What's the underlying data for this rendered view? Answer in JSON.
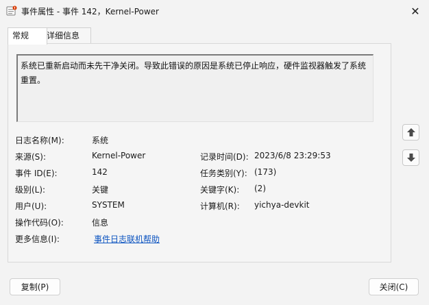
{
  "window": {
    "title": "事件属性 - 事件 142，Kernel-Power",
    "close_label": "✕"
  },
  "tabs": [
    {
      "label": "常规",
      "active": true
    },
    {
      "label": "详细信息",
      "active": false
    }
  ],
  "description": "系统已重新启动而未先干净关闭。导致此错误的原因是系统已停止响应，硬件监视器触发了系统重置。",
  "fields": {
    "log_name": {
      "label": "日志名称(M):",
      "value": "系统"
    },
    "source": {
      "label": "来源(S):",
      "value": "Kernel-Power"
    },
    "logged": {
      "label": "记录时间(D):",
      "value": "2023/6/8 23:29:53"
    },
    "event_id": {
      "label": "事件 ID(E):",
      "value": "142"
    },
    "task_category": {
      "label": "任务类别(Y):",
      "value": "(173)"
    },
    "level": {
      "label": "级别(L):",
      "value": "关键"
    },
    "keywords": {
      "label": "关键字(K):",
      "value": "(2)"
    },
    "user": {
      "label": "用户(U):",
      "value": "SYSTEM"
    },
    "computer": {
      "label": "计算机(R):",
      "value": "yichya-devkit"
    },
    "opcode": {
      "label": "操作代码(O):",
      "value": "信息"
    },
    "more_info": {
      "label": "更多信息(I):",
      "value": "事件日志联机帮助"
    }
  },
  "buttons": {
    "copy": "复制(P)",
    "close": "关闭(C)"
  },
  "icons": {
    "app": "event-viewer-icon",
    "nav_up": "arrow-up-icon",
    "nav_down": "arrow-down-icon"
  }
}
